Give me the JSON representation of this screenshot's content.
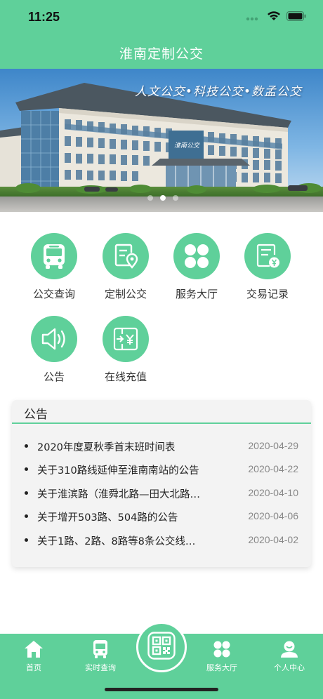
{
  "status_bar": {
    "time": "11:25"
  },
  "header": {
    "title": "淮南定制公交"
  },
  "banner": {
    "slogan": "人文公交•科技公交•数孟公交",
    "building_sign": "淮南公交",
    "slide_count": 3,
    "active_slide": 2
  },
  "menu": [
    {
      "label": "公交查询",
      "icon": "bus-icon"
    },
    {
      "label": "定制公交",
      "icon": "document-location-icon"
    },
    {
      "label": "服务大厅",
      "icon": "four-dots-icon"
    },
    {
      "label": "交易记录",
      "icon": "receipt-yen-icon"
    },
    {
      "label": "公告",
      "icon": "speaker-icon"
    },
    {
      "label": "在线充值",
      "icon": "recharge-yen-icon"
    }
  ],
  "notice": {
    "title": "公告",
    "items": [
      {
        "text": "2020年度夏秋季首末班时间表",
        "date": "2020-04-29"
      },
      {
        "text": "关于310路线延伸至淮南南站的公告",
        "date": "2020-04-22"
      },
      {
        "text": "关于淮滨路（淮舜北路—田大北路…",
        "date": "2020-04-10"
      },
      {
        "text": "关于增开503路、504路的公告",
        "date": "2020-04-06"
      },
      {
        "text": "关于1路、2路、8路等8条公交线…",
        "date": "2020-04-02"
      }
    ]
  },
  "tabbar": {
    "home": "首页",
    "realtime": "实时查询",
    "service": "服务大厅",
    "profile": "个人中心",
    "center_icon": "qr-code-icon"
  },
  "colors": {
    "accent": "#5fd09a",
    "background": "#ffffff",
    "card": "#f3f3f3"
  }
}
